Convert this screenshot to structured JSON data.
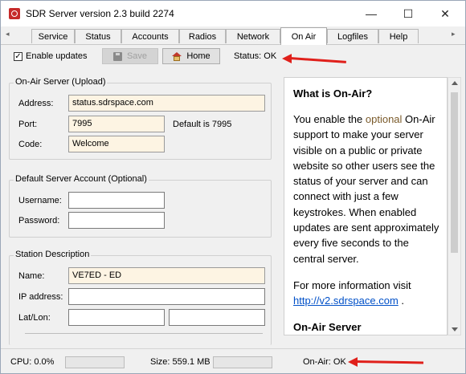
{
  "window": {
    "title": "SDR Server version 2.3 build 2274"
  },
  "window_controls": {
    "minimize": "—",
    "maximize": "☐",
    "close": "✕"
  },
  "tabs": [
    {
      "label": "Service"
    },
    {
      "label": "Status"
    },
    {
      "label": "Accounts"
    },
    {
      "label": "Radios"
    },
    {
      "label": "Network"
    },
    {
      "label": "On Air",
      "active": true
    },
    {
      "label": "Logfiles"
    },
    {
      "label": "Help"
    }
  ],
  "tab_scroll": {
    "left": "◂",
    "right": "▸"
  },
  "toolbar": {
    "enable_updates_label": "Enable updates",
    "enable_updates_checked": true,
    "save_label": "Save",
    "home_label": "Home",
    "status_text": "Status: OK"
  },
  "onair_server": {
    "title": "On-Air Server (Upload)",
    "address_label": "Address:",
    "address_value": "status.sdrspace.com",
    "port_label": "Port:",
    "port_value": "7995",
    "port_default": "Default is 7995",
    "code_label": "Code:",
    "code_value": "Welcome"
  },
  "default_account": {
    "title": "Default Server Account (Optional)",
    "username_label": "Username:",
    "username_value": "",
    "password_label": "Password:",
    "password_value": ""
  },
  "station": {
    "title": "Station Description",
    "name_label": "Name:",
    "name_value": "VE7ED - ED",
    "ip_label": "IP address:",
    "ip_value": "",
    "latlon_label": "Lat/Lon:",
    "lat_value": "",
    "lon_value": ""
  },
  "info_panel": {
    "heading": "What is On-Air?",
    "para1_before": "You enable the ",
    "para1_highlight": "optional",
    "para1_after": " On-Air support to make your server visible on a public or private website so other users see the status of your server and can connect with just a few keystrokes. When enabled updates are sent approximately every five seconds to the central server.",
    "para2_before": "For more information visit ",
    "para2_link": "http://v2.sdrspace.com",
    "para2_after": " .",
    "heading2": "On-Air Server"
  },
  "statusbar": {
    "cpu": "CPU: 0.0%",
    "size": "Size: 559.1 MB",
    "onair": "On-Air: OK"
  },
  "colors": {
    "annotation_arrow": "#e0201b",
    "input_highlight": "#fdf4e3",
    "link": "#0050c8"
  }
}
